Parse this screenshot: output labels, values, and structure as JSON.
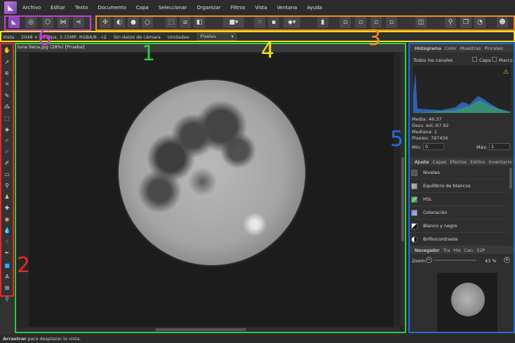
{
  "menu": [
    "Archivo",
    "Editar",
    "Texto",
    "Documento",
    "Capa",
    "Seleccionar",
    "Organizar",
    "Filtros",
    "Vista",
    "Ventana",
    "Ayuda"
  ],
  "context": {
    "view_label": "Vista",
    "doc_info": "2048 × 1536px, 3.15MP, RGBA/8 - c2",
    "camera": "Sin datos de cámara",
    "units_label": "Unidades:",
    "units_value": "Píxeles"
  },
  "document": {
    "tab_title": "luna llena.jpg (28%) [Prueba]"
  },
  "histogram": {
    "tabs": [
      "Histograma",
      "Color",
      "Muestras",
      "Pinceles"
    ],
    "channels": "Todos los canales",
    "layer_label": "Capa",
    "frame_label": "Marco",
    "stats": [
      "Media: 46.37",
      "Desv. est.:67.92",
      "Mediana: 1",
      "Píxeles: 787456"
    ],
    "min_label": "Mín:",
    "min_value": "0",
    "max_label": "Máx:",
    "max_value": "1"
  },
  "adjust": {
    "tabs": [
      "Ajuste",
      "Capas",
      "Efectos",
      "Estilos",
      "Inventario"
    ],
    "items": [
      "Niveles",
      "Equilibrio de blancos",
      "HSL",
      "Coloración",
      "Blanco y negro",
      "Brillo/contraste"
    ]
  },
  "navigator": {
    "tabs": [
      "Navegador",
      "Tra",
      "His",
      "Can",
      "32P"
    ],
    "zoom_label": "Zoom:",
    "zoom_value": "43 %"
  },
  "status": {
    "bold": "Arrastrar",
    "text": " para desplazar la vista."
  },
  "annotations": [
    "1",
    "2",
    "3",
    "4",
    "5",
    "6"
  ],
  "annotation_colors": {
    "1": "#2ecc40",
    "2": "#e02a2a",
    "3": "#f58a1f",
    "4": "#f3e21b",
    "5": "#1f6fe0",
    "6": "#c63fd6"
  }
}
